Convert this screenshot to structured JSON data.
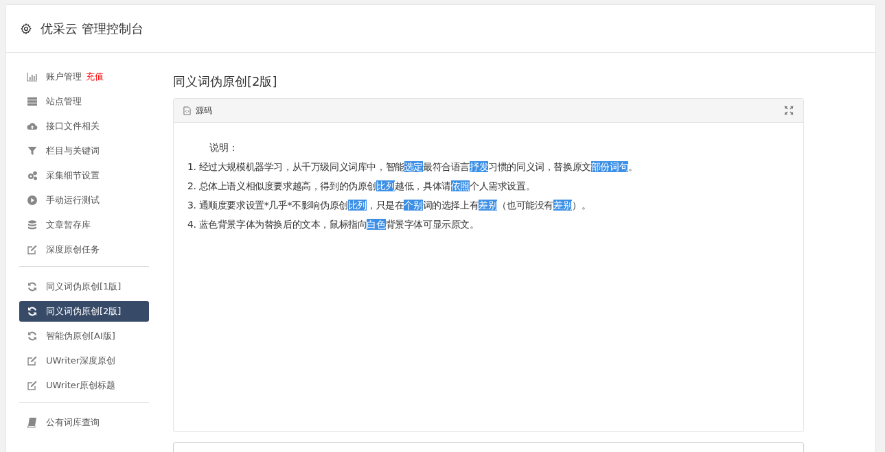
{
  "header": {
    "title": "优采云 管理控制台"
  },
  "sidebar": {
    "groups": [
      {
        "items": [
          {
            "label": "账户管理",
            "badge": "充值",
            "selected": false
          },
          {
            "label": "站点管理",
            "selected": false
          },
          {
            "label": "接口文件相关",
            "selected": false
          },
          {
            "label": "栏目与关键词",
            "selected": false
          },
          {
            "label": "采集细节设置",
            "selected": false
          },
          {
            "label": "手动运行测试",
            "selected": false
          },
          {
            "label": "文章暂存库",
            "selected": false
          },
          {
            "label": "深度原创任务",
            "selected": false
          }
        ]
      },
      {
        "items": [
          {
            "label": "同义词伪原创[1版]",
            "selected": false
          },
          {
            "label": "同义词伪原创[2版]",
            "selected": true
          },
          {
            "label": "智能伪原创[AI版]",
            "selected": false
          },
          {
            "label": "UWriter深度原创",
            "selected": false
          },
          {
            "label": "UWriter原创标题",
            "selected": false
          }
        ]
      },
      {
        "items": [
          {
            "label": "公有词库查询",
            "selected": false
          }
        ]
      }
    ]
  },
  "main": {
    "title": "同义词伪原创[2版]",
    "editor": {
      "toolbar_label": "源码",
      "heading": "说明：",
      "lines": [
        [
          {
            "text": "1. 经过大规模机器学习，从千万级同义词库中，智能",
            "highlighted": false
          },
          {
            "text": "选定",
            "highlighted": true
          },
          {
            "text": "最符合语言",
            "highlighted": false
          },
          {
            "text": "抒发",
            "highlighted": true
          },
          {
            "text": "习惯的同义词，替换原文",
            "highlighted": false
          },
          {
            "text": "部份",
            "highlighted": true
          },
          {
            "text": "词句",
            "highlighted": true
          },
          {
            "text": "。",
            "highlighted": false
          }
        ],
        [
          {
            "text": "2. 总体上语义相似度要求越高，得到的伪原创",
            "highlighted": false
          },
          {
            "text": "比列",
            "highlighted": true
          },
          {
            "text": "越低，具体请",
            "highlighted": false
          },
          {
            "text": "依照",
            "highlighted": true
          },
          {
            "text": "个人需求设置。",
            "highlighted": false
          }
        ],
        [
          {
            "text": "3. 通顺度要求设置*几乎*不影响伪原创",
            "highlighted": false
          },
          {
            "text": "比列",
            "highlighted": true
          },
          {
            "text": "，只是在",
            "highlighted": false
          },
          {
            "text": "个别",
            "highlighted": true
          },
          {
            "text": "词的选择上有",
            "highlighted": false
          },
          {
            "text": "差别",
            "highlighted": true
          },
          {
            "text": "（也可能没有",
            "highlighted": false
          },
          {
            "text": "差别",
            "highlighted": true
          },
          {
            "text": "）。",
            "highlighted": false
          }
        ],
        [
          {
            "text": "4. 蓝色背景字体为替换后的文本，鼠标指向",
            "highlighted": false
          },
          {
            "text": "白色",
            "highlighted": true
          },
          {
            "text": "背景字体可显示原文。",
            "highlighted": false
          }
        ]
      ]
    }
  }
}
